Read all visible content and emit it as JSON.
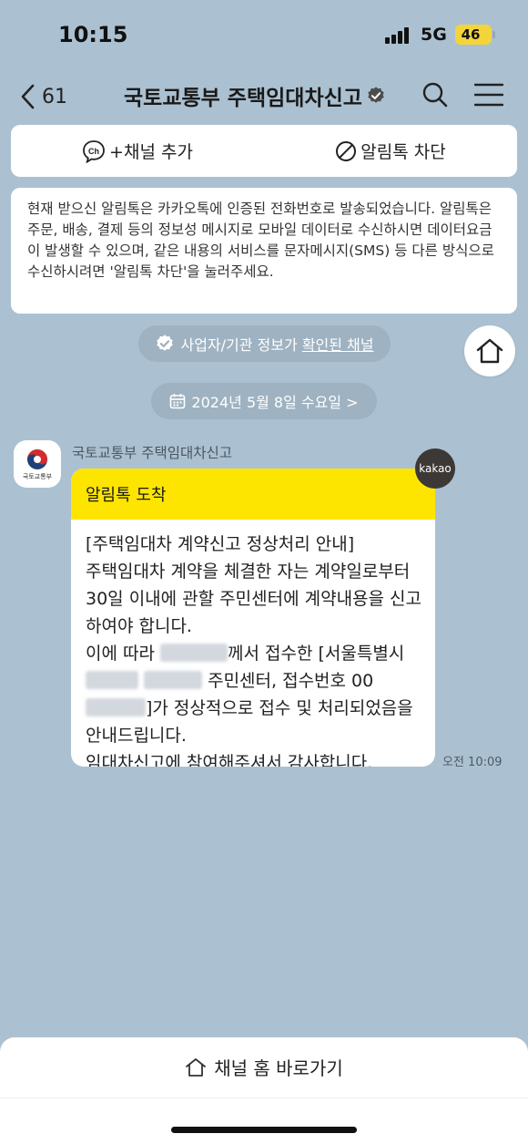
{
  "status_bar": {
    "time": "10:15",
    "network": "5G",
    "battery": "46"
  },
  "nav": {
    "back_count": "61",
    "title": "국토교통부 주택임대차신고"
  },
  "actions": {
    "add_channel": "+채널 추가",
    "block": "알림톡 차단"
  },
  "notice": "현재 받으신 알림톡은 카카오톡에 인증된 전화번호로 발송되었습니다. 알림톡은 주문, 배송, 결제 등의 정보성 메시지로 모바일 데이터로 수신하시면 데이터요금이 발생할 수 있으며, 같은 내용의 서비스를 문자메시지(SMS) 등 다른 방식으로 수신하시려면 '알림톡 차단'을 눌러주세요.",
  "verified_pill": {
    "prefix": "사업자/기관 정보가 ",
    "link": "확인된 채널"
  },
  "date_pill": "2024년 5월 8일 수요일 >",
  "message": {
    "avatar_caption": "국토교통부",
    "sender": "국토교통부 주택임대차신고",
    "kakao_badge": "kakao",
    "header": "알림톡 도착",
    "body_1": "[주택임대차 계약신고 정상처리 안내]\n주택임대차 계약을 체결한 자는 계약일로부터 30일 이내에 관할 주민센터에 계약내용을 신고하여야 합니다.\n이에 따라 ",
    "body_2": "께서 접수한 [서울특별시 ",
    "body_3": " 주민센터, 접수번호 00",
    "body_4": "]가 정상적으로 접수 및 처리되었음을 안내드립니다.\n임대차신고에 참여해주셔서 감사합니다.",
    "time": "오전 10:09"
  },
  "bottom": {
    "home_link": "채널 홈 바로가기"
  },
  "colors": {
    "background": "#abc1d1",
    "kakao_yellow": "#fee500",
    "pill": "#9eb2c1"
  }
}
